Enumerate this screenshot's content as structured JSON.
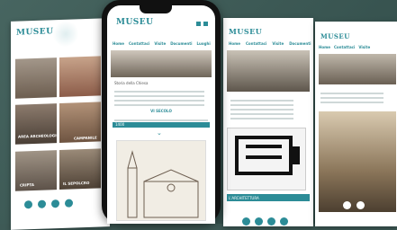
{
  "brand": {
    "logo": "MUSEU"
  },
  "nav": {
    "items": [
      "Home",
      "Contattaci",
      "Visite",
      "Documenti",
      "Luoghi"
    ],
    "lang": "IT EN"
  },
  "left_tiles": [
    {
      "label": ""
    },
    {
      "label": ""
    },
    {
      "label": "AREA ARCHEOLOGICA"
    },
    {
      "label": "CAMPANILE"
    },
    {
      "label": "CRIPTA"
    },
    {
      "label": "IL SEPOLCRO"
    }
  ],
  "phone": {
    "page_heading": "Storia della Chiesa",
    "section_title": "VI SECOLO",
    "card_header": "1400"
  },
  "s3": {
    "card_header": "L'ARCHITETTURA"
  },
  "social": [
    "twitter-icon",
    "facebook-icon",
    "instagram-icon",
    "youtube-icon"
  ],
  "colors": {
    "accent": "#2c8c97",
    "background": "#3e5a56"
  }
}
